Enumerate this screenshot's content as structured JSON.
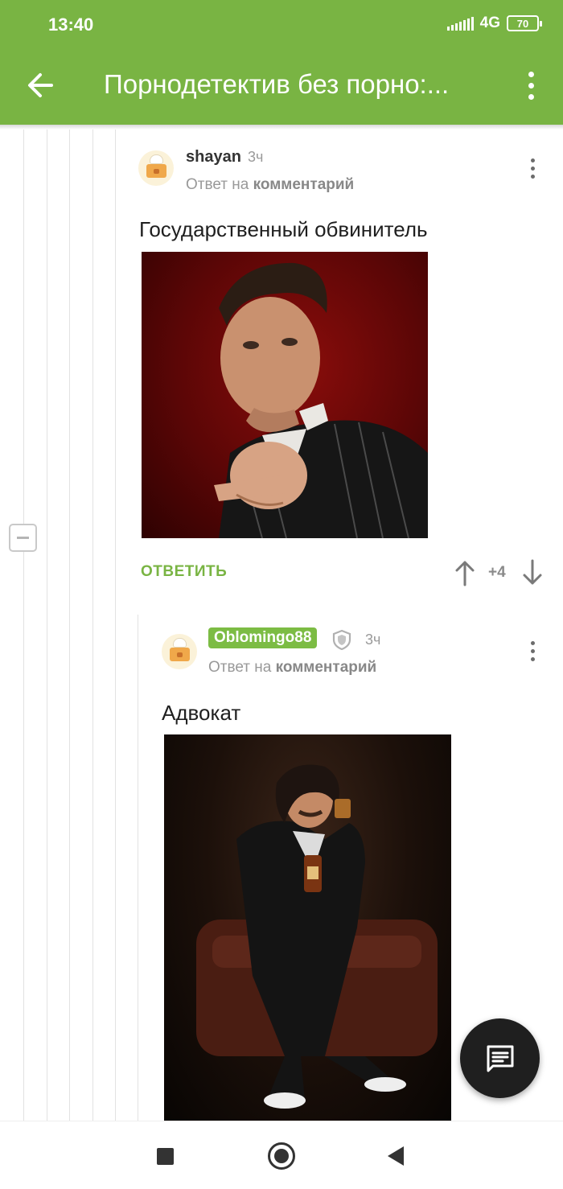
{
  "status_bar": {
    "time": "13:40",
    "network": "4G",
    "battery": "70"
  },
  "app_bar": {
    "title": "Порнодетектив без порно:..."
  },
  "comments": [
    {
      "username": "shayan",
      "time": "3ч",
      "reply_prefix": "Ответ на",
      "reply_link": "комментарий",
      "text": "Государственный обвинитель",
      "image_description": "photo",
      "reply_label": "ОТВЕТИТЬ",
      "score": "+4"
    },
    {
      "username": "Oblomingo88",
      "time": "3ч",
      "reply_prefix": "Ответ на",
      "reply_link": "комментарий",
      "text": "Адвокат",
      "image_description": "photo"
    }
  ],
  "icons": {
    "back": "arrow-left-icon",
    "menu": "more-vert-icon",
    "comment_menu": "more-vert-icon",
    "shield": "shield-icon",
    "vote_up": "arrow-up-icon",
    "vote_down": "arrow-down-icon",
    "fab": "comment-icon",
    "collapse": "minus-icon"
  },
  "colors": {
    "accent": "#79b443",
    "fab": "#1f1f1f"
  }
}
